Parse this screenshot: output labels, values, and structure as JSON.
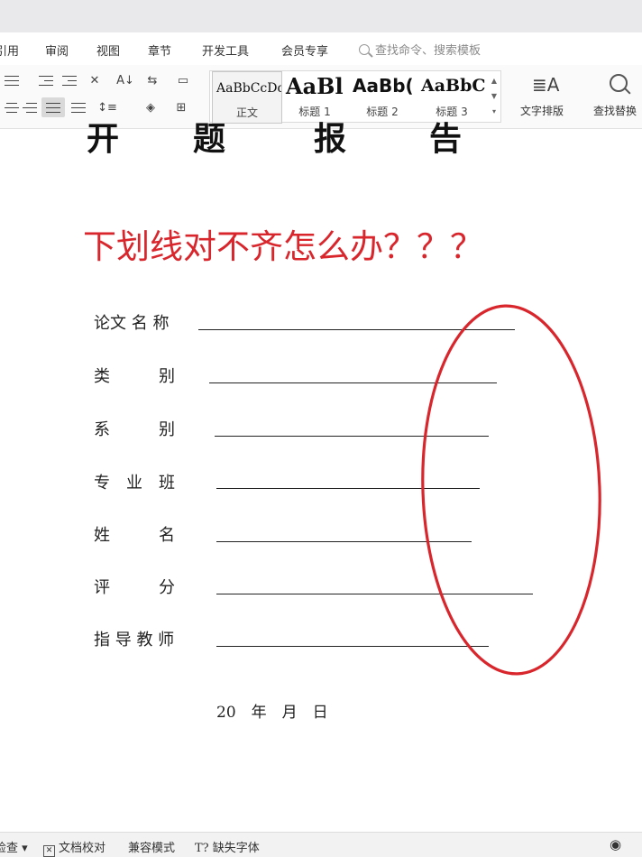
{
  "menu": {
    "items": [
      "引用",
      "审阅",
      "视图",
      "章节",
      "开发工具",
      "会员专享"
    ],
    "search_placeholder": "查找命令、搜索模板"
  },
  "ribbon": {
    "styles": [
      {
        "preview": "AaBbCcDd",
        "name": "正文"
      },
      {
        "preview": "AaBl",
        "name": "标题 1"
      },
      {
        "preview": "AaBb(",
        "name": "标题 2"
      },
      {
        "preview": "AaBbC",
        "name": "标题 3"
      }
    ],
    "text_layout_label": "文字排版",
    "find_replace_label": "查找替换"
  },
  "document": {
    "cut_title_chars": [
      "开",
      "题",
      "报",
      "告"
    ],
    "question": "下划线对不齐怎么办？？？",
    "fields": [
      {
        "label": "论文 名 称"
      },
      {
        "label": "类　　　别"
      },
      {
        "label": "系　　　别"
      },
      {
        "label": "专　业　班"
      },
      {
        "label": "姓　　　名"
      },
      {
        "label": "评　　　分"
      },
      {
        "label": "指 导 教 师"
      }
    ],
    "date": "20　年　月　日",
    "annotation_color": "#d8262c"
  },
  "statusbar": {
    "check": "检查",
    "proofread": "文档校对",
    "compat_mode": "兼容模式",
    "missing_font": "缺失字体"
  }
}
